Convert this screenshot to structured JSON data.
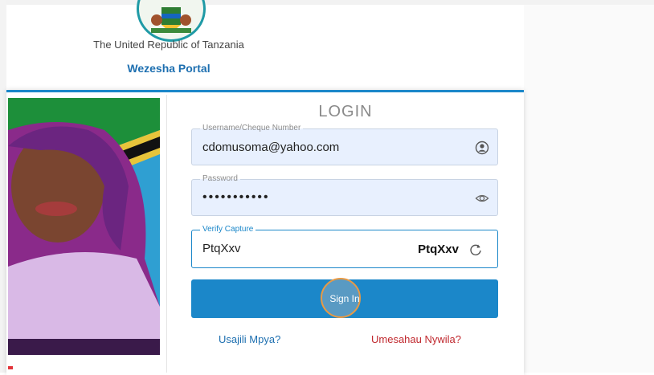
{
  "header": {
    "country": "The United Republic of Tanzania",
    "portal_name": "Wezesha Portal"
  },
  "login": {
    "title": "LOGIN",
    "username": {
      "label": "Username/Cheque Number",
      "value": "cdomusoma@yahoo.com"
    },
    "password": {
      "label": "Password",
      "value": "•••••••••••"
    },
    "captcha": {
      "label": "Verify Capture",
      "value": "PtqXxv",
      "code": "PtqXxv"
    },
    "sign_in_label": "Sign In",
    "register_link": "Usajili Mpya?",
    "forgot_link": "Umesahau Nywila?"
  },
  "colors": {
    "primary": "#1b87c9",
    "link_blue": "#1d6fb0",
    "link_red": "#c0282e",
    "field_bg": "#e8f0fe"
  },
  "icons": {
    "username": "user-icon",
    "password": "eye-icon",
    "captcha": "refresh-icon"
  }
}
